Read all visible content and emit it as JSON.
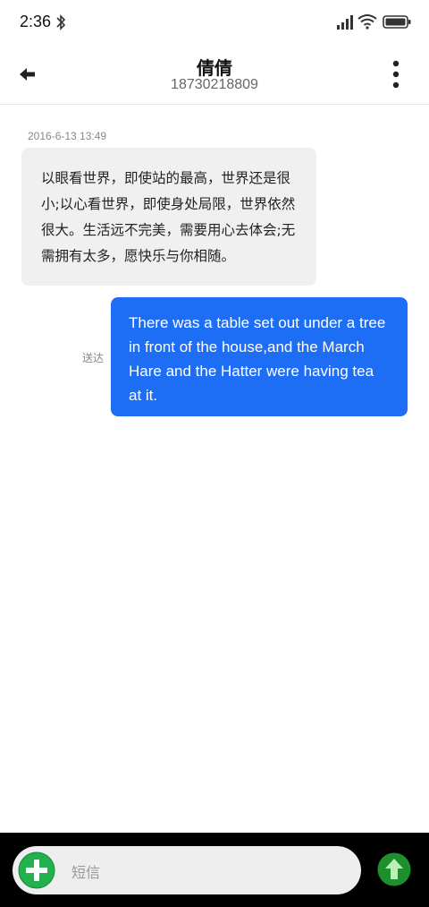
{
  "status_bar": {
    "time": "2:36"
  },
  "header": {
    "contact_name": "倩倩",
    "contact_number": "18730218809"
  },
  "messages": [
    {
      "direction": "incoming",
      "timestamp": "2016-6-13 13:49",
      "text": "以眼看世界，即使站的最高，世界还是很小;以心看世界，即使身处局限，世界依然很大。生活远不完美，需要用心去体会;无需拥有太多，愿快乐与你相随。"
    },
    {
      "direction": "outgoing",
      "status": "送达",
      "text": "There was a table set out under a tree in front of the house,and the March Hare and the Hatter were having tea at it."
    }
  ],
  "composer": {
    "placeholder": "短信"
  },
  "colors": {
    "outgoing_bubble": "#1e6ef5",
    "incoming_bubble": "#f0f0f0",
    "add_button": "#22b14c",
    "send_button": "#1f8f2e"
  },
  "icons": {
    "back": "back-arrow-icon",
    "more": "more-vertical-icon",
    "add": "add-circle-icon",
    "send": "send-up-arrow-icon"
  }
}
